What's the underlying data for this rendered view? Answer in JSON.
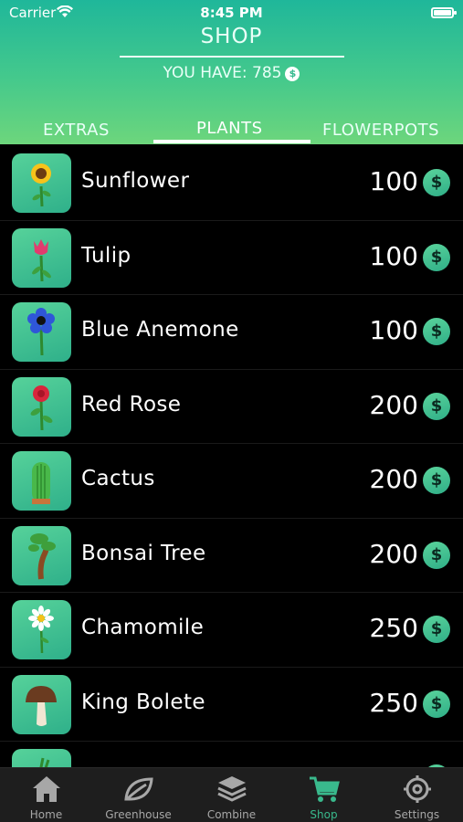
{
  "status": {
    "carrier": "Carrier",
    "time": "8:45 PM"
  },
  "header": {
    "title": "SHOP",
    "balance_label": "YOU HAVE: 785",
    "coin_symbol": "$"
  },
  "tabs": [
    {
      "label": "EXTRAS",
      "active": false
    },
    {
      "label": "PLANTS",
      "active": true
    },
    {
      "label": "FLOWERPOTS",
      "active": false
    }
  ],
  "items": [
    {
      "name": "Sunflower",
      "price": "100",
      "icon": "sunflower-icon"
    },
    {
      "name": "Tulip",
      "price": "100",
      "icon": "tulip-icon"
    },
    {
      "name": "Blue Anemone",
      "price": "100",
      "icon": "blue-anemone-icon"
    },
    {
      "name": "Red Rose",
      "price": "200",
      "icon": "red-rose-icon"
    },
    {
      "name": "Cactus",
      "price": "200",
      "icon": "cactus-icon"
    },
    {
      "name": "Bonsai Tree",
      "price": "200",
      "icon": "bonsai-icon"
    },
    {
      "name": "Chamomile",
      "price": "250",
      "icon": "chamomile-icon"
    },
    {
      "name": "King Bolete",
      "price": "250",
      "icon": "mushroom-icon"
    }
  ],
  "currency_symbol": "$",
  "tabbar": [
    {
      "label": "Home",
      "icon": "home-icon",
      "active": false
    },
    {
      "label": "Greenhouse",
      "icon": "leaf-icon",
      "active": false
    },
    {
      "label": "Combine",
      "icon": "layers-icon",
      "active": false
    },
    {
      "label": "Shop",
      "icon": "cart-icon",
      "active": true
    },
    {
      "label": "Settings",
      "icon": "gear-icon",
      "active": false
    }
  ],
  "colors": {
    "accent": "#39b98c",
    "header_top": "#1fb79a",
    "header_bottom": "#6dd67c"
  }
}
